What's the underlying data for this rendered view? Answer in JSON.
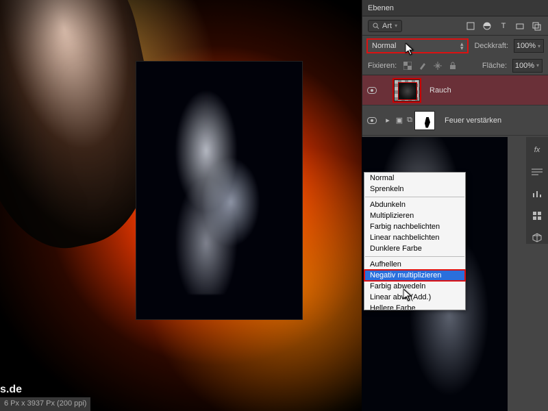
{
  "panel": {
    "title": "Ebenen",
    "filter_label": "Art",
    "lock_label": "Fixieren:",
    "opacity_label": "Deckkraft:",
    "fill_label": "Fläche:",
    "opacity_value": "100%",
    "fill_value": "100%"
  },
  "blend_mode": {
    "current": "Normal",
    "groups": [
      [
        "Normal",
        "Sprenkeln"
      ],
      [
        "Abdunkeln",
        "Multiplizieren",
        "Farbig nachbelichten",
        "Linear nachbelichten",
        "Dunklere Farbe"
      ],
      [
        "Aufhellen",
        "Negativ multiplizieren",
        "Farbig abwedeln",
        "Linear abw. (Add.)",
        "Hellere Farbe"
      ]
    ],
    "highlighted": "Negativ multiplizieren"
  },
  "layers": [
    {
      "name": "Rauch",
      "visible": true,
      "selected": true,
      "group": false
    },
    {
      "name": "Feuer verstärken",
      "visible": true,
      "selected": false,
      "group": true
    }
  ],
  "status": "6 Px x 3937 Px (200 ppi)",
  "watermark": "s.de"
}
